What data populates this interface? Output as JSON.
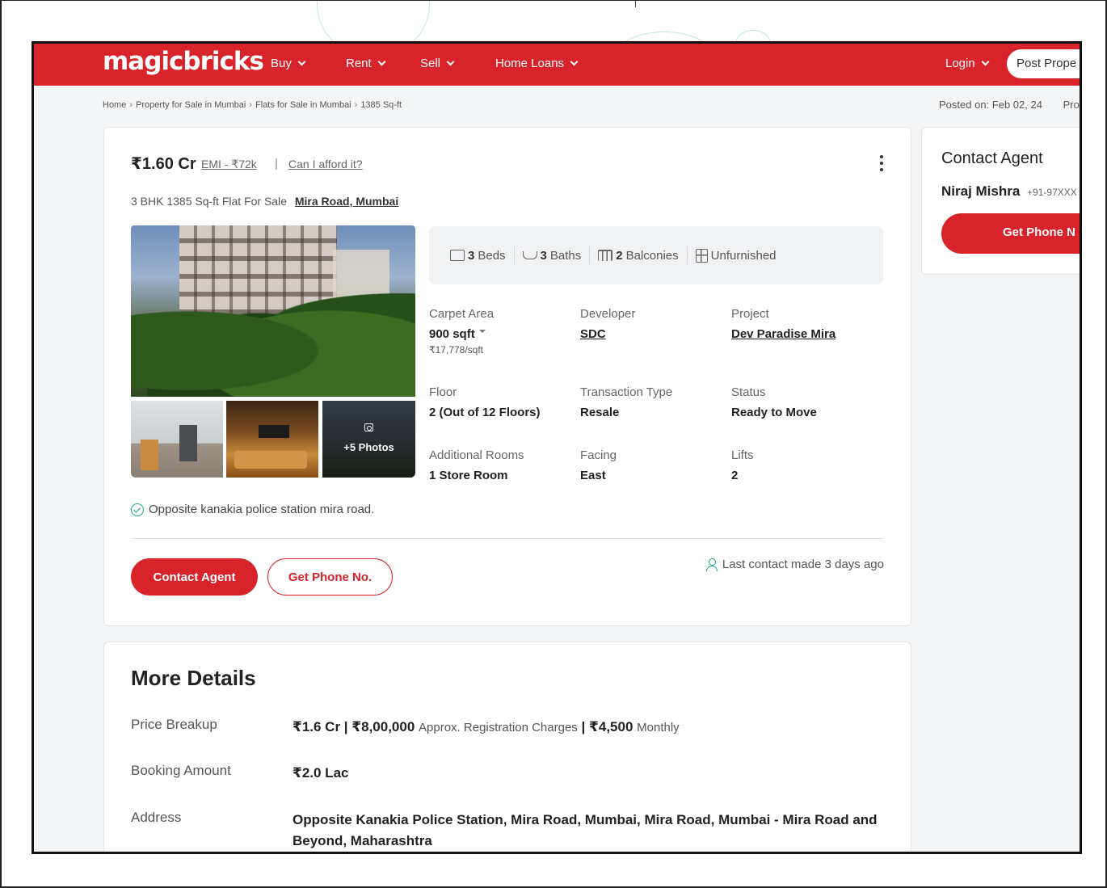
{
  "header": {
    "logo": "magicbricks",
    "nav": [
      {
        "label": "Buy"
      },
      {
        "label": "Rent"
      },
      {
        "label": "Sell"
      },
      {
        "label": "Home Loans"
      }
    ],
    "login": "Login",
    "post_property": "Post Prope"
  },
  "breadcrumb": {
    "items": [
      "Home",
      "Property for Sale in Mumbai",
      "Flats for Sale in Mumbai",
      "1385 Sq-ft"
    ],
    "posted": "Posted on: Feb 02, 24",
    "posted_tail": "Pro"
  },
  "listing": {
    "price": "₹1.60 Cr",
    "emi": "EMI - ₹72k",
    "separator": "|",
    "afford": "Can I afford it?",
    "subtitle": "3 BHK 1385 Sq-ft Flat For Sale",
    "location": "Mira Road, Mumbai",
    "photos_label": "+5 Photos",
    "amenities": [
      {
        "count": "3",
        "label": "Beds",
        "icon": "bed-icon"
      },
      {
        "count": "3",
        "label": "Baths",
        "icon": "bath-icon"
      },
      {
        "count": "2",
        "label": "Balconies",
        "icon": "balcony-icon"
      },
      {
        "count": "",
        "label": "Unfurnished",
        "icon": "furnishing-icon"
      }
    ],
    "specs": {
      "carpet_area": {
        "label": "Carpet Area",
        "value": "900 sqft",
        "sub": "₹17,778/sqft"
      },
      "developer": {
        "label": "Developer",
        "value": "SDC"
      },
      "project": {
        "label": "Project",
        "value": "Dev Paradise Mira"
      },
      "floor": {
        "label": "Floor",
        "value": "2 (Out of 12 Floors)"
      },
      "transaction": {
        "label": "Transaction Type",
        "value": "Resale"
      },
      "status": {
        "label": "Status",
        "value": "Ready to Move"
      },
      "additional_rooms": {
        "label": "Additional Rooms",
        "value": "1 Store Room"
      },
      "facing": {
        "label": "Facing",
        "value": "East"
      },
      "lifts": {
        "label": "Lifts",
        "value": "2"
      }
    },
    "landmark": "Opposite kanakia police station mira road.",
    "contact_button": "Contact Agent",
    "phone_button": "Get Phone No.",
    "last_contact": "Last contact made 3 days ago"
  },
  "contact_card": {
    "title": "Contact Agent",
    "agent_name": "Niraj Mishra",
    "agent_phone": "+91-97XXX",
    "button": "Get Phone N"
  },
  "more_details": {
    "title": "More Details",
    "price_breakup": {
      "label": "Price Breakup",
      "price": "₹1.6 Cr | ₹8,00,000",
      "reg": "Approx. Registration Charges",
      "sep": "|",
      "monthly_amount": "₹4,500",
      "monthly": "Monthly"
    },
    "booking": {
      "label": "Booking Amount",
      "value": "₹2.0 Lac"
    },
    "address": {
      "label": "Address",
      "value": "Opposite Kanakia Police Station, Mira Road, Mumbai, Mira Road, Mumbai - Mira Road and Beyond, Maharashtra"
    }
  },
  "colors": {
    "brand_red": "#d8232a",
    "accent_green": "#17a589"
  }
}
